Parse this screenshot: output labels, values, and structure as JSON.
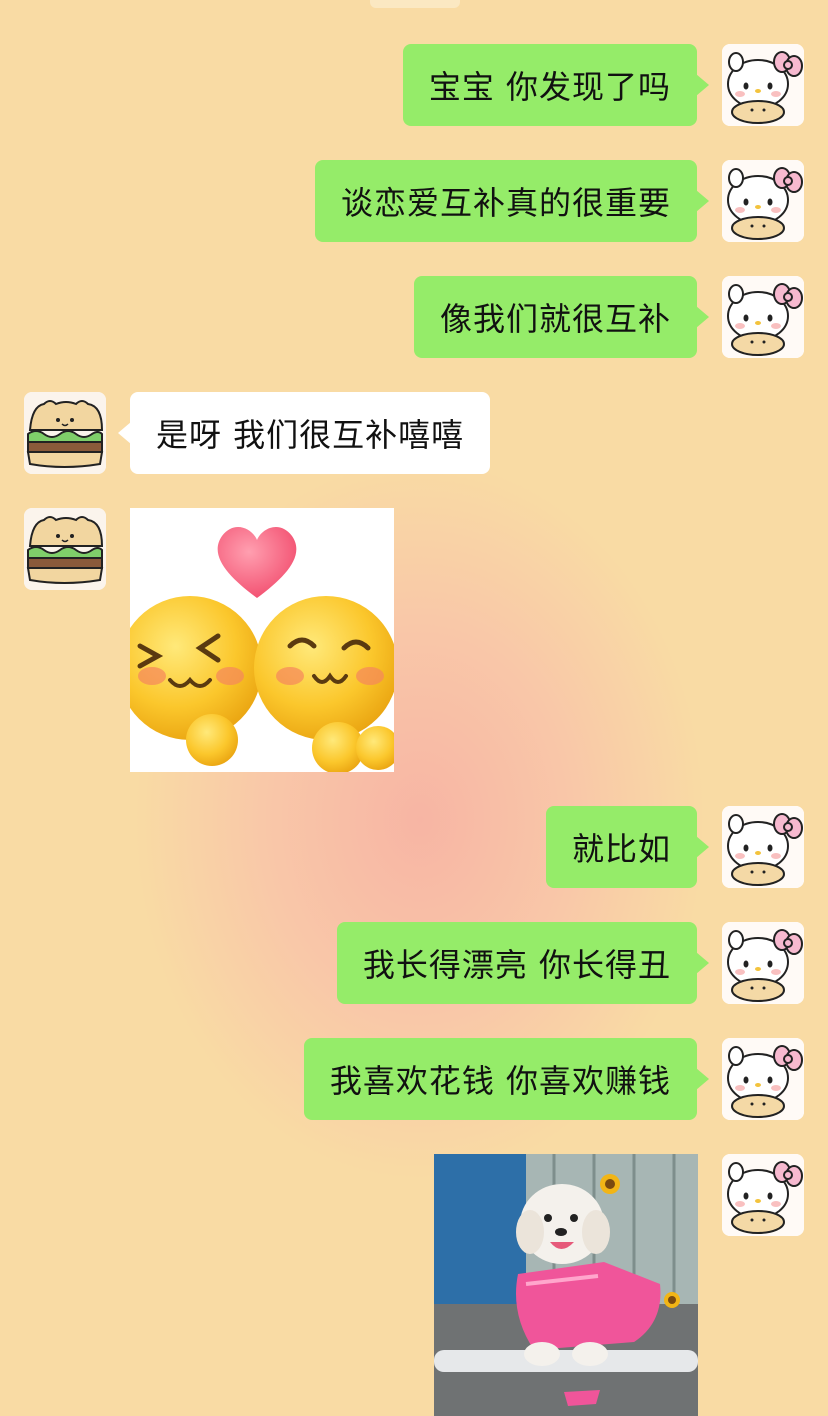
{
  "messages": [
    {
      "from": "me",
      "text": "宝宝 你发现了吗"
    },
    {
      "from": "me",
      "text": "谈恋爱互补真的很重要"
    },
    {
      "from": "me",
      "text": "像我们就很互补"
    },
    {
      "from": "them",
      "text": "是呀 我们很互补嘻嘻"
    },
    {
      "from": "them",
      "type": "sticker",
      "sticker": "two-smiling-emoji-heart-sticker"
    },
    {
      "from": "me",
      "text": "就比如"
    },
    {
      "from": "me",
      "text": "我长得漂亮 你长得丑"
    },
    {
      "from": "me",
      "text": "我喜欢花钱 你喜欢赚钱"
    },
    {
      "from": "me",
      "type": "sticker",
      "sticker": "dog-in-pink-dress-sticker"
    }
  ],
  "avatars": {
    "me": "hello-kitty-avatar",
    "them": "sandwich-bear-avatar"
  },
  "colors": {
    "my_bubble": "#95ec69",
    "their_bubble": "#ffffff",
    "background": "#f9dba4"
  }
}
